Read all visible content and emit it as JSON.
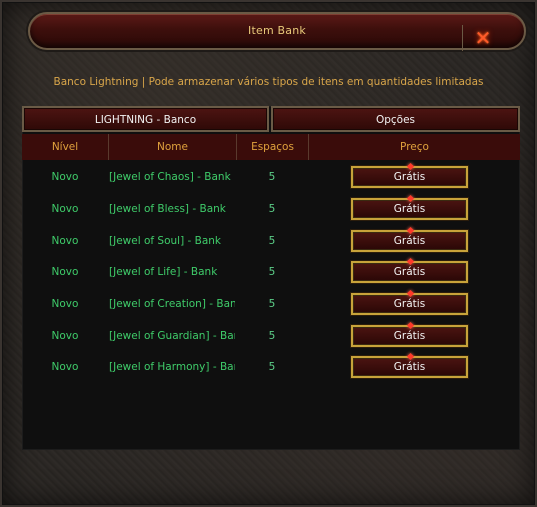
{
  "window": {
    "title": "Item Bank"
  },
  "info_text": "Banco Lightning | Pode armazenar vários tipos de itens em quantidades limitadas",
  "tabs": {
    "bank": "LIGHTNING - Banco",
    "options": "Opções"
  },
  "columns": {
    "nivel": "Nível",
    "nome": "Nome",
    "espacos": "Espaços",
    "preco": "Preço"
  },
  "rows": [
    {
      "nivel": "Novo",
      "nome": "[Jewel of Chaos] - Bank",
      "espacos": "5",
      "preco": "Grátis"
    },
    {
      "nivel": "Novo",
      "nome": "[Jewel of Bless] - Bank",
      "espacos": "5",
      "preco": "Grátis"
    },
    {
      "nivel": "Novo",
      "nome": "[Jewel of Soul] - Bank",
      "espacos": "5",
      "preco": "Grátis"
    },
    {
      "nivel": "Novo",
      "nome": "[Jewel of Life] - Bank",
      "espacos": "5",
      "preco": "Grátis"
    },
    {
      "nivel": "Novo",
      "nome": "[Jewel of Creation] - Bank",
      "espacos": "5",
      "preco": "Grátis"
    },
    {
      "nivel": "Novo",
      "nome": "[Jewel of Guardian] - Bank",
      "espacos": "5",
      "preco": "Grátis"
    },
    {
      "nivel": "Novo",
      "nome": "[Jewel of Harmony] - Bank",
      "espacos": "5",
      "preco": "Grátis"
    }
  ],
  "colors": {
    "title_gold": "#e8c97a",
    "info_gold": "#d9a64a",
    "header_gold": "#e0a23d",
    "row_green": "#3fcc6a",
    "button_border": "#c8a33a",
    "close_red": "#ff5a2a"
  },
  "icons": {
    "close": "close-x-icon",
    "button_gem": "red-gem-icon"
  }
}
